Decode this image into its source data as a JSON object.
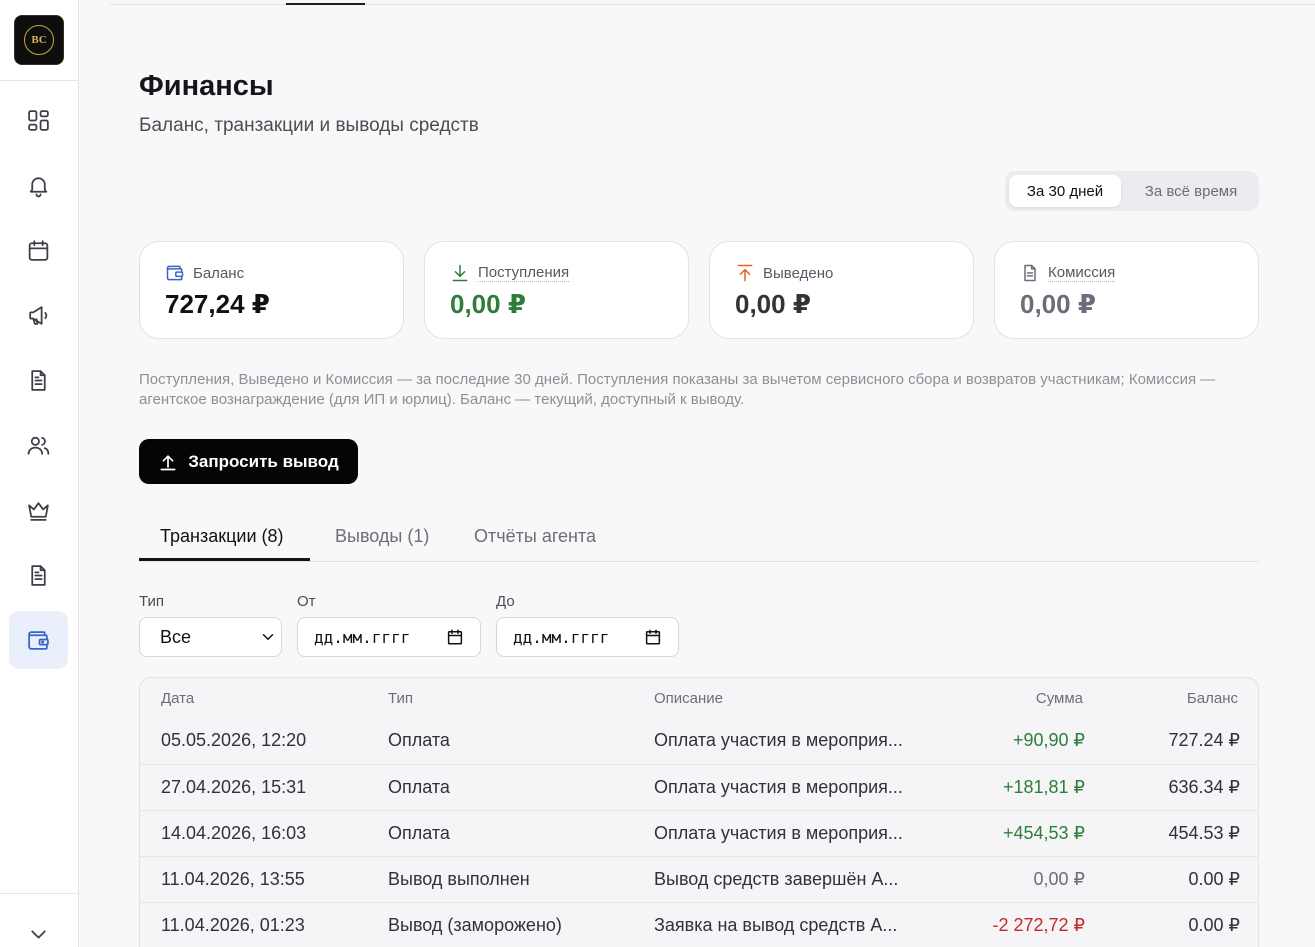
{
  "page": {
    "title": "Финансы",
    "subtitle": "Баланс, транзакции и выводы средств"
  },
  "period": {
    "options": [
      "За 30 дней",
      "За всё время"
    ],
    "selected": "За 30 дней"
  },
  "cards": [
    {
      "label": "Баланс",
      "value": "727,24 ₽",
      "icon": "wallet-icon",
      "color": "#111111"
    },
    {
      "label": "Поступления",
      "value": "0,00 ₽",
      "icon": "download-icon",
      "color": "#2e7d3a"
    },
    {
      "label": "Выведено",
      "value": "0,00 ₽",
      "icon": "upload-icon",
      "color": "#333333"
    },
    {
      "label": "Комиссия",
      "value": "0,00 ₽",
      "icon": "document-icon",
      "color": "#6b6e78"
    }
  ],
  "note": "Поступления, Выведено и Комиссия — за последние 30 дней. Поступления показаны за вычетом сервисного сбора и возвратов участникам; Комиссия — агентское вознаграждение (для ИП и юрлиц). Баланс — текущий, доступный к выводу.",
  "withdraw_button": "Запросить вывод",
  "tabs": [
    "Транзакции (8)",
    "Выводы (1)",
    "Отчёты агента"
  ],
  "filters": {
    "type_label": "Тип",
    "type_value": "Все",
    "from_label": "От",
    "from_placeholder": "дд.мм.гггг",
    "to_label": "До",
    "to_placeholder": "дд.мм.гггг"
  },
  "table": {
    "headers": [
      "Дата",
      "Тип",
      "Описание",
      "Сумма",
      "Баланс"
    ],
    "rows": [
      {
        "date": "05.05.2026, 12:20",
        "type": "Оплата",
        "desc": "Оплата участия в мероприя...",
        "amount": "+90,90 ₽",
        "balance": "727.24 ₽",
        "kind": "pos"
      },
      {
        "date": "27.04.2026, 15:31",
        "type": "Оплата",
        "desc": "Оплата участия в мероприя...",
        "amount": "+181,81 ₽",
        "balance": "636.34 ₽",
        "kind": "pos"
      },
      {
        "date": "14.04.2026, 16:03",
        "type": "Оплата",
        "desc": "Оплата участия в мероприя...",
        "amount": "+454,53 ₽",
        "balance": "454.53 ₽",
        "kind": "pos"
      },
      {
        "date": "11.04.2026, 13:55",
        "type": "Вывод выполнен",
        "desc": "Вывод средств завершён А...",
        "amount": "0,00 ₽",
        "balance": "0.00 ₽",
        "kind": "zero"
      },
      {
        "date": "11.04.2026, 01:23",
        "type": "Вывод (заморожено)",
        "desc": "Заявка на вывод средств А...",
        "amount": "-2 272,72 ₽",
        "balance": "0.00 ₽",
        "kind": "neg"
      }
    ]
  }
}
